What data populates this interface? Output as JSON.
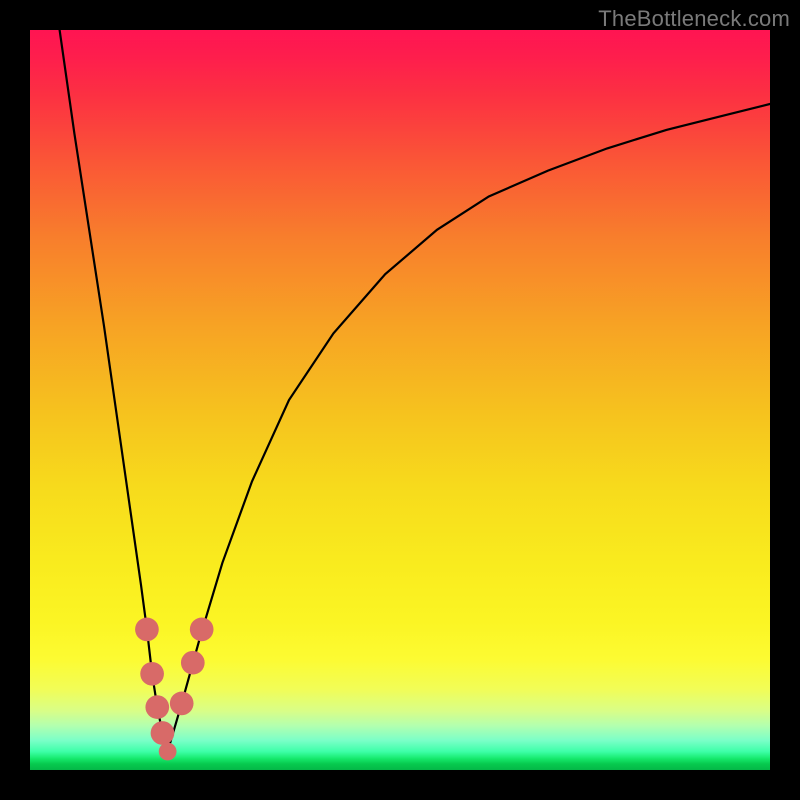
{
  "watermark": "TheBottleneck.com",
  "colors": {
    "frame": "#000000",
    "curve": "#000000",
    "markers": "#D86A68"
  },
  "chart_data": {
    "type": "line",
    "title": "",
    "xlabel": "",
    "ylabel": "",
    "xlim": [
      0,
      100
    ],
    "ylim": [
      0,
      100
    ],
    "grid": false,
    "note": "Axis values are synthetic percent-of-plot coordinates estimated from pixel positions; the source image has no tick labels.",
    "series": [
      {
        "name": "left-branch",
        "x": [
          4,
          6,
          8,
          10,
          11,
          12,
          13,
          14,
          15,
          15.8,
          16.5,
          17.2,
          17.9,
          18.6
        ],
        "y": [
          100,
          86,
          73,
          60,
          53,
          46,
          39,
          32,
          25,
          19,
          13,
          8.5,
          5,
          2.5
        ]
      },
      {
        "name": "right-branch",
        "x": [
          18.6,
          20.5,
          23,
          26,
          30,
          35,
          41,
          48,
          55,
          62,
          70,
          78,
          86,
          94,
          100
        ],
        "y": [
          2.5,
          9,
          18,
          28,
          39,
          50,
          59,
          67,
          73,
          77.5,
          81,
          84,
          86.5,
          88.5,
          90
        ]
      }
    ],
    "markers": [
      {
        "x": 15.8,
        "y": 19,
        "r": 1.6
      },
      {
        "x": 16.5,
        "y": 13,
        "r": 1.6
      },
      {
        "x": 17.2,
        "y": 8.5,
        "r": 1.6
      },
      {
        "x": 17.9,
        "y": 5,
        "r": 1.6
      },
      {
        "x": 18.6,
        "y": 2.5,
        "r": 1.2
      },
      {
        "x": 20.5,
        "y": 9,
        "r": 1.6
      },
      {
        "x": 22.0,
        "y": 14.5,
        "r": 1.6
      },
      {
        "x": 23.2,
        "y": 19,
        "r": 1.6
      }
    ]
  }
}
